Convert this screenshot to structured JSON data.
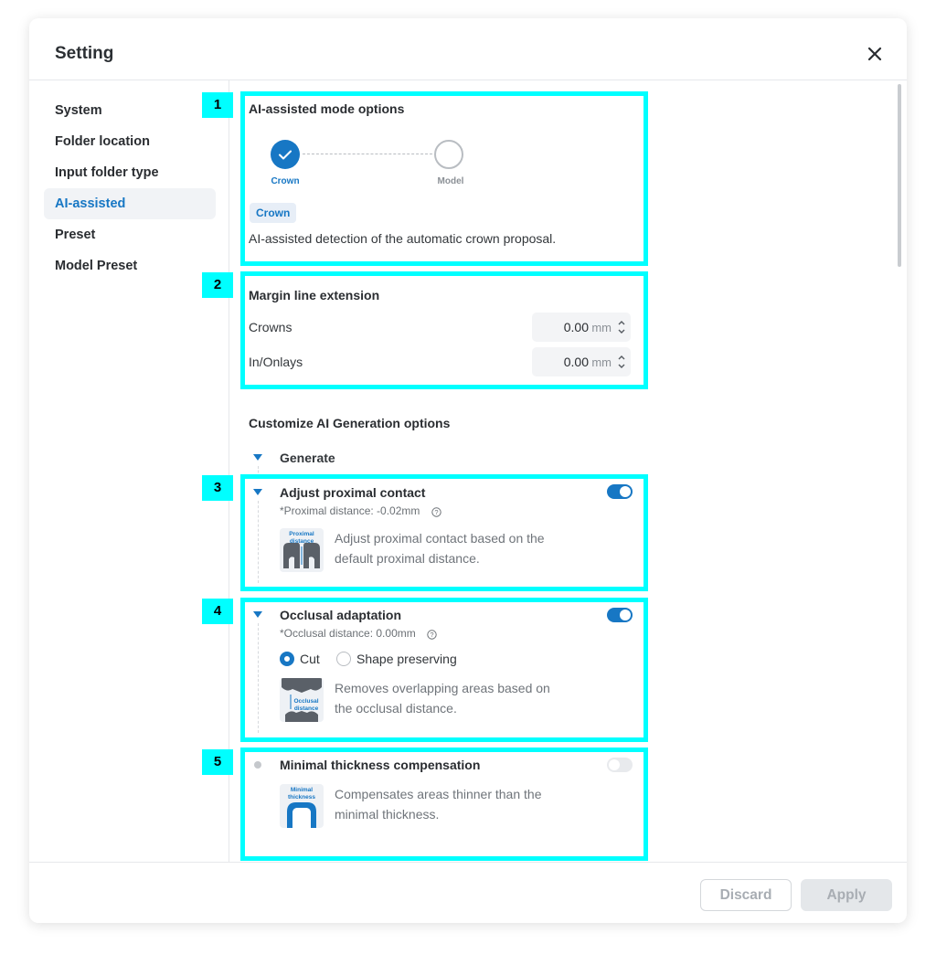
{
  "dialog": {
    "title": "Setting"
  },
  "sidebar": {
    "items": [
      {
        "label": "System"
      },
      {
        "label": "Folder location"
      },
      {
        "label": "Input folder type"
      },
      {
        "label": "AI-assisted"
      },
      {
        "label": "Preset"
      },
      {
        "label": "Model Preset"
      }
    ],
    "active": "AI-assisted"
  },
  "ai_mode": {
    "title": "AI-assisted mode options",
    "steps": [
      {
        "label": "Crown"
      },
      {
        "label": "Model"
      }
    ],
    "selected_chip": "Crown",
    "description": "AI-assisted detection of the automatic crown proposal."
  },
  "margin": {
    "title": "Margin line extension",
    "rows": [
      {
        "label": "Crowns",
        "value": "0.00",
        "unit": "mm"
      },
      {
        "label": "In/Onlays",
        "value": "0.00",
        "unit": "mm"
      }
    ]
  },
  "customize": {
    "title": "Customize AI Generation options",
    "generate_label": "Generate",
    "proximal": {
      "title": "Adjust proximal contact",
      "sub": "*Proximal distance: -0.02mm",
      "thumb_text": "Proximal distance",
      "desc_line1": "Adjust proximal contact based on the",
      "desc_line2": "default proximal distance.",
      "enabled": true
    },
    "occlusal": {
      "title": "Occlusal adaptation",
      "sub": "*Occlusal distance: 0.00mm",
      "options": [
        {
          "label": "Cut"
        },
        {
          "label": "Shape preserving"
        }
      ],
      "selected_option": "Cut",
      "thumb_text": "Occlusal distance",
      "desc_line1": "Removes overlapping areas based on",
      "desc_line2": "the occlusal distance.",
      "enabled": true
    },
    "minimal": {
      "title": "Minimal thickness compensation",
      "thumb_text": "Minimal thickness",
      "desc_line1": "Compensates areas thinner than the",
      "desc_line2": "minimal thickness.",
      "enabled": false
    }
  },
  "annotations": [
    "1",
    "2",
    "3",
    "4",
    "5"
  ],
  "footer": {
    "discard_label": "Discard",
    "apply_label": "Apply"
  },
  "colors": {
    "accent": "#1777c4",
    "highlight": "#00ffff",
    "text": "#2a2d31"
  }
}
